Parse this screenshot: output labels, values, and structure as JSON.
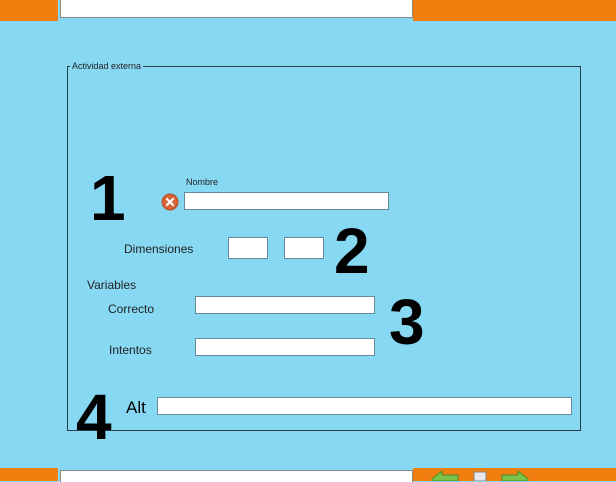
{
  "fieldset": {
    "legend": "Actividad externa"
  },
  "annotations": [
    "1",
    "2",
    "3",
    "4"
  ],
  "nombre": {
    "label": "Nombre",
    "value": ""
  },
  "dimensiones": {
    "label": "Dimensiones",
    "width_value": "",
    "height_value": ""
  },
  "variables": {
    "heading": "Variables",
    "correcto": {
      "label": "Correcto",
      "value": ""
    },
    "intentos": {
      "label": "Intentos",
      "value": ""
    }
  },
  "alt": {
    "label": "Alt",
    "value": ""
  },
  "icons": {
    "error": "close-circle-icon",
    "prev": "arrow-left-icon",
    "next": "arrow-right-icon"
  },
  "colors": {
    "background": "#86d8f3",
    "bar": "#f07f10",
    "error_icon": "#c0522a"
  }
}
